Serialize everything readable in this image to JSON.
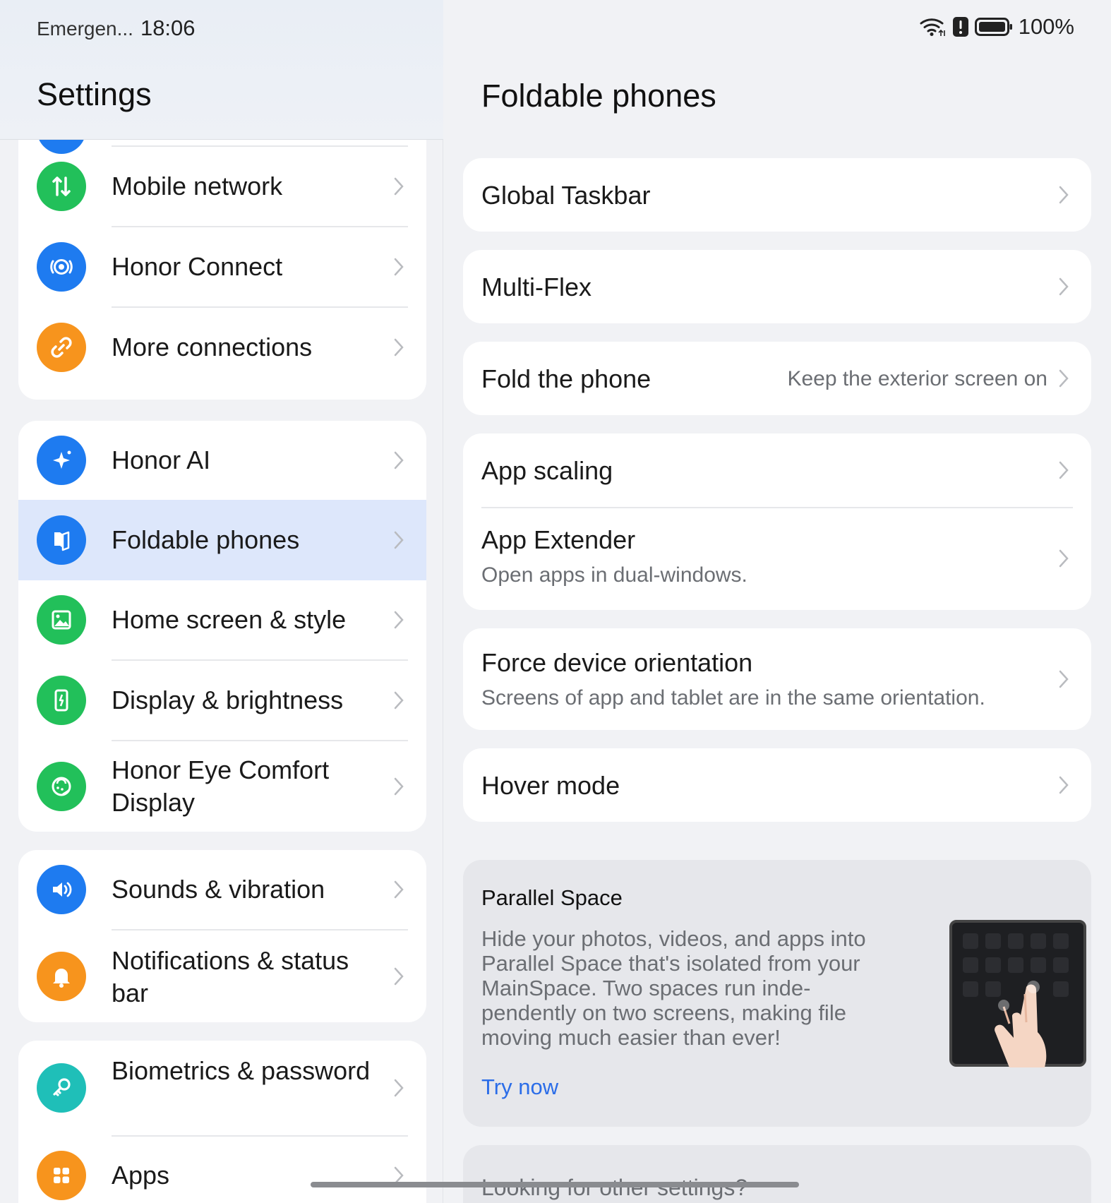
{
  "status_bar": {
    "emergency": "Emergen...",
    "time": "18:06",
    "battery": "100%"
  },
  "left": {
    "title": "Settings",
    "items": [
      {
        "label": "Mobile network",
        "icon": "mobile-network-icon",
        "color": "#22c05a"
      },
      {
        "label": "Honor Connect",
        "icon": "honor-connect-icon",
        "color": "#1e7bf0"
      },
      {
        "label": "More connections",
        "icon": "link-icon",
        "color": "#f7941d"
      },
      {
        "label": "Honor AI",
        "icon": "sparkle-icon",
        "color": "#1e7bf0"
      },
      {
        "label": "Foldable phones",
        "icon": "foldable-icon",
        "color": "#1e7bf0"
      },
      {
        "label": "Home screen & style",
        "icon": "image-icon",
        "color": "#22c05a"
      },
      {
        "label": "Display & brightness",
        "icon": "display-icon",
        "color": "#22c05a"
      },
      {
        "label": "Honor Eye Comfort Display",
        "icon": "eye-comfort-icon",
        "color": "#22c05a"
      },
      {
        "label": "Sounds & vibration",
        "icon": "speaker-icon",
        "color": "#1e7bf0"
      },
      {
        "label": "Notifications & status bar",
        "icon": "bell-icon",
        "color": "#f7941d"
      },
      {
        "label": "Biometrics & password",
        "icon": "key-icon",
        "color": "#1fbfb8"
      },
      {
        "label": "Apps",
        "icon": "apps-grid-icon",
        "color": "#f7941d"
      }
    ]
  },
  "right": {
    "title": "Foldable phones",
    "global_taskbar": "Global Taskbar",
    "multi_flex": "Multi-Flex",
    "fold_phone": {
      "label": "Fold the phone",
      "value": "Keep the exterior screen on"
    },
    "app_scaling": "App scaling",
    "app_extender": {
      "label": "App Extender",
      "sub": "Open apps in dual-windows."
    },
    "force_orientation": {
      "label": "Force device orientation",
      "sub": "Screens of app and tablet are in the same orientation."
    },
    "hover_mode": "Hover mode",
    "promo": {
      "title": "Parallel Space",
      "body": "Hide your photos, videos, and apps into Parallel Space that's isolated from your MainSpace. Two spaces run inde-pendently on two screens, making file moving much easier than ever!",
      "link": "Try now"
    },
    "other_settings": "Looking for other settings?"
  },
  "colors": {
    "accent": "#2b6de8",
    "selected_row": "#dde7fb",
    "background": "#f1f2f5"
  }
}
